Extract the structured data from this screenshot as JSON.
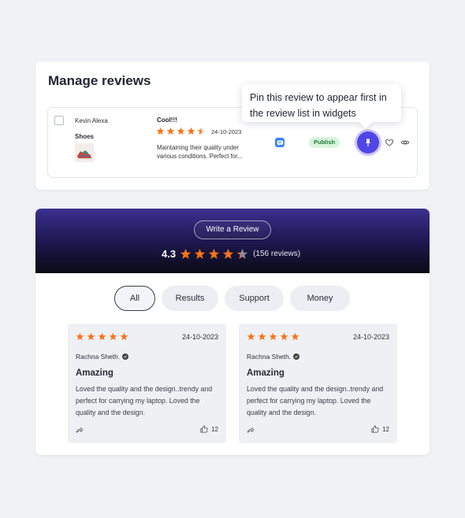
{
  "manage": {
    "title": "Manage reviews",
    "row": {
      "reviewer": "Kevin Alexa",
      "product": "Shoes",
      "review_title": "Cool!!!",
      "rating": 4.5,
      "date": "24-10-2023",
      "excerpt": "Maintaining their quality under various conditions. Perfect for...",
      "status": "Publish"
    },
    "tooltip": "Pin this review to appear first in the review list in widgets"
  },
  "widget": {
    "write_review_label": "Write a Review",
    "rating_value": "4.3",
    "rating": 4.3,
    "review_count": "(156 reviews)",
    "filters": [
      {
        "label": "All",
        "active": true
      },
      {
        "label": "Results",
        "active": false
      },
      {
        "label": "Support",
        "active": false
      },
      {
        "label": "Money",
        "active": false
      }
    ],
    "reviews": [
      {
        "rating": 5,
        "date": "24-10-2023",
        "author": "Rachna Sheth.",
        "title": "Amazing",
        "body": "Loved the quality and the design..trendy and perfect for carrying my laptop. Loved the quality and the design.",
        "likes": "12"
      },
      {
        "rating": 5,
        "date": "24-10-2023",
        "author": "Rachna Sheth.",
        "title": "Amazing",
        "body": "Loved the quality and the design..trendy and perfect for carrying my laptop. Loved the quality and the design.",
        "likes": "12"
      }
    ]
  },
  "colors": {
    "accent": "#4f46e5",
    "star": "#f97316",
    "publish_bg": "#d8f5dc",
    "publish_text": "#1d7a35",
    "header_gradient_top": "#3b3190",
    "header_gradient_bottom": "#0a0a14"
  },
  "icons": [
    "checkbox-icon",
    "chat-icon",
    "pin-icon",
    "heart-icon",
    "eye-icon",
    "star-icon",
    "verified-icon",
    "share-icon",
    "thumbs-up-icon"
  ]
}
